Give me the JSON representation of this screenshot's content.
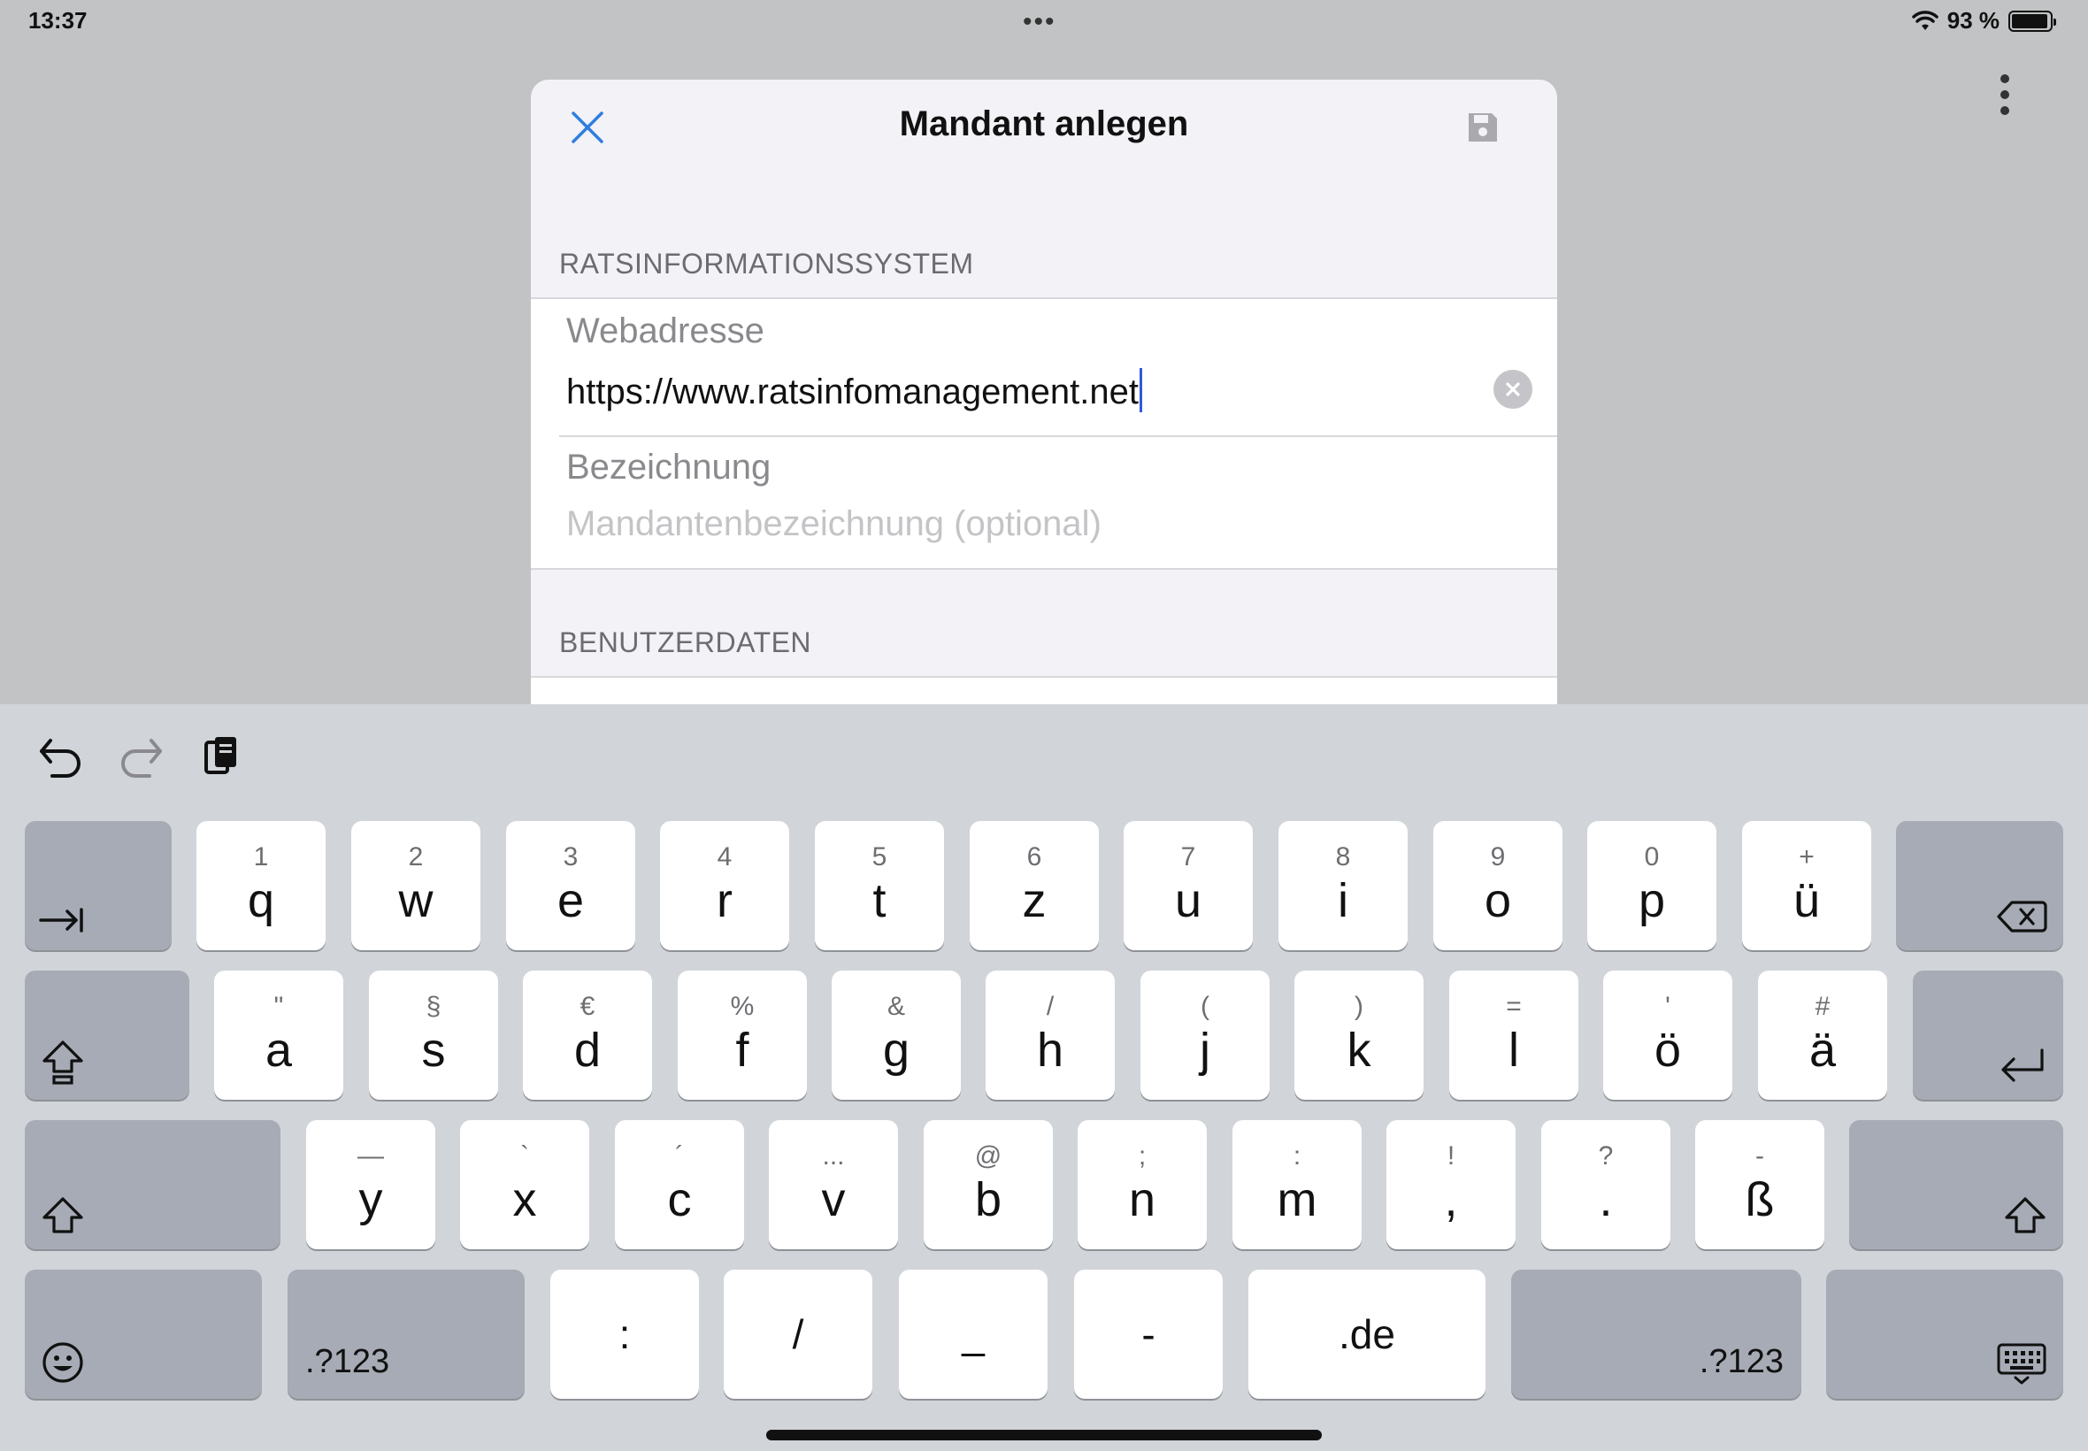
{
  "status_bar": {
    "time": "13:37",
    "battery_text": "93 %",
    "dots": "•••"
  },
  "sheet": {
    "title": "Mandant anlegen",
    "section1_header": "RATSINFORMATIONSSYSTEM",
    "web_label": "Webadresse",
    "web_value": "https://www.ratsinfomanagement.net",
    "name_label": "Bezeichnung",
    "name_placeholder": "Mandantenbezeichnung (optional)",
    "section2_header": "BENUTZERDATEN"
  },
  "keyboard": {
    "row1": [
      {
        "sec": "1",
        "pri": "q"
      },
      {
        "sec": "2",
        "pri": "w"
      },
      {
        "sec": "3",
        "pri": "e"
      },
      {
        "sec": "4",
        "pri": "r"
      },
      {
        "sec": "5",
        "pri": "t"
      },
      {
        "sec": "6",
        "pri": "z"
      },
      {
        "sec": "7",
        "pri": "u"
      },
      {
        "sec": "8",
        "pri": "i"
      },
      {
        "sec": "9",
        "pri": "o"
      },
      {
        "sec": "0",
        "pri": "p"
      },
      {
        "sec": "+",
        "pri": "ü"
      }
    ],
    "row2": [
      {
        "sec": "\"",
        "pri": "a"
      },
      {
        "sec": "§",
        "pri": "s"
      },
      {
        "sec": "€",
        "pri": "d"
      },
      {
        "sec": "%",
        "pri": "f"
      },
      {
        "sec": "&",
        "pri": "g"
      },
      {
        "sec": "/",
        "pri": "h"
      },
      {
        "sec": "(",
        "pri": "j"
      },
      {
        "sec": ")",
        "pri": "k"
      },
      {
        "sec": "=",
        "pri": "l"
      },
      {
        "sec": "'",
        "pri": "ö"
      },
      {
        "sec": "#",
        "pri": "ä"
      }
    ],
    "row3": [
      {
        "sec": "—",
        "pri": "y"
      },
      {
        "sec": "`",
        "pri": "x"
      },
      {
        "sec": "´",
        "pri": "c"
      },
      {
        "sec": "...",
        "pri": "v"
      },
      {
        "sec": "@",
        "pri": "b"
      },
      {
        "sec": ";",
        "pri": "n"
      },
      {
        "sec": ":",
        "pri": "m"
      },
      {
        "sec": "!",
        "pri": ","
      },
      {
        "sec": "?",
        "pri": "."
      },
      {
        "sec": "-",
        "pri": "ß"
      }
    ],
    "row4": {
      "numbers_left": ".?123",
      "colon": ":",
      "slash": "/",
      "underscore": "_",
      "dash": "-",
      "tld": ".de",
      "numbers_right": ".?123"
    }
  },
  "colors": {
    "accent": "#2f7de1",
    "caret": "#2f5bd8",
    "keyboard_bg": "#d1d4d9"
  }
}
